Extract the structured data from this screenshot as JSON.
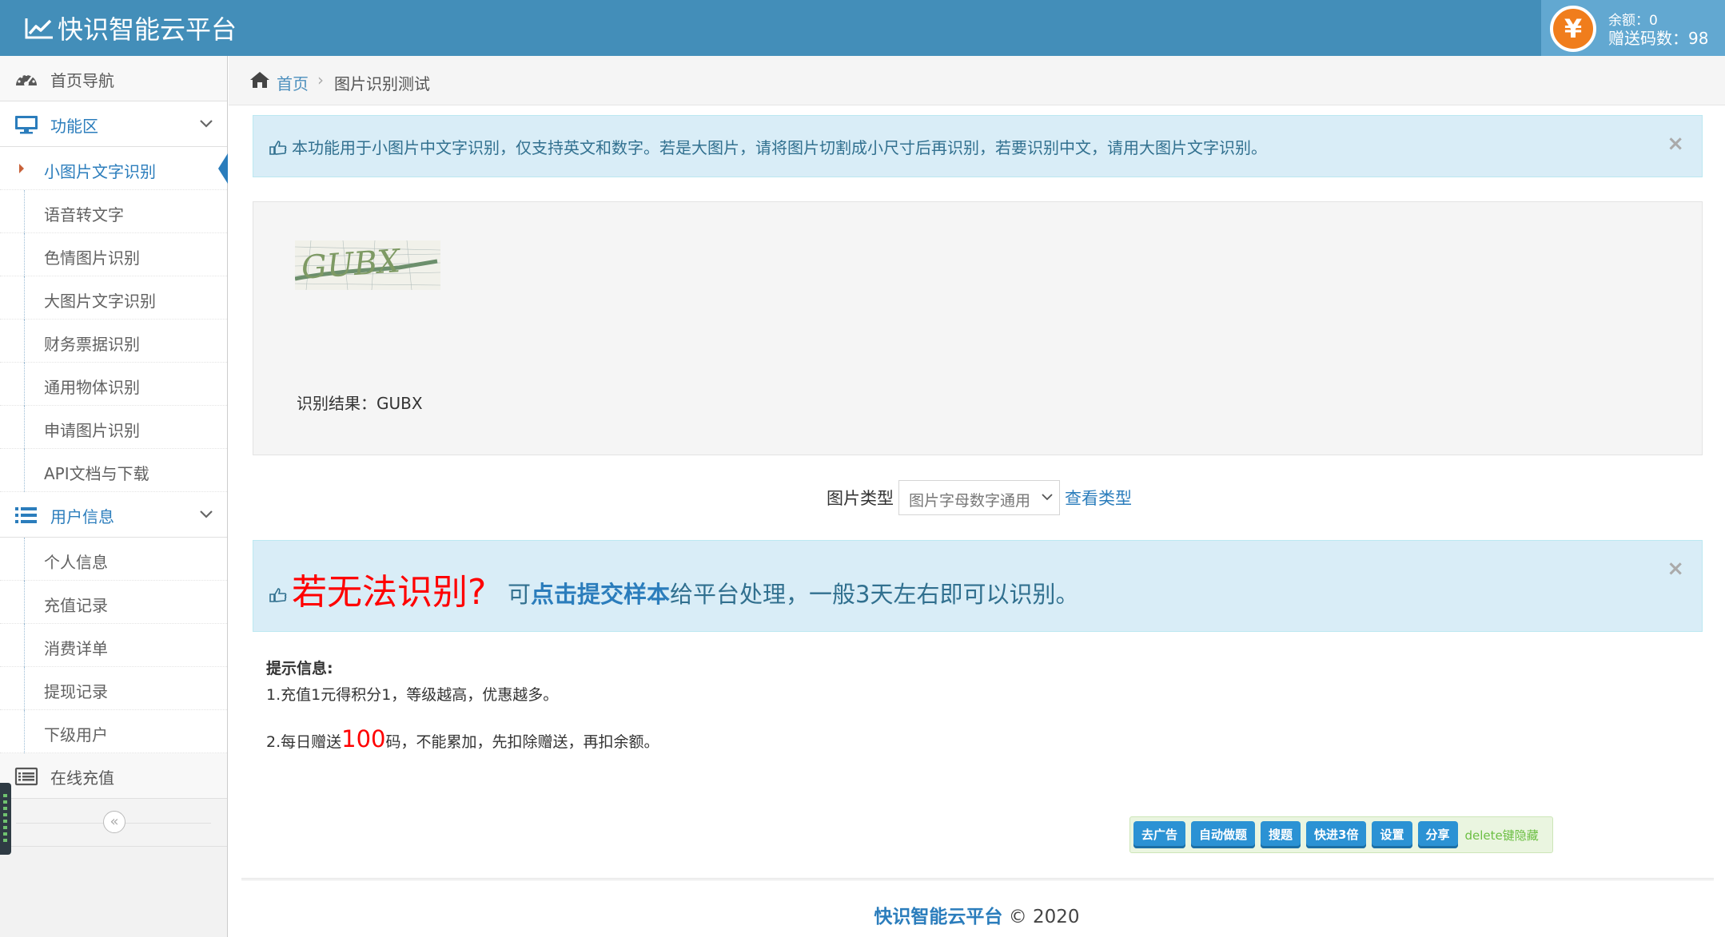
{
  "header": {
    "brand": "快识智能云平台",
    "coin_symbol": "¥",
    "balance_line": "余额：0",
    "gift_line": "赠送码数：98"
  },
  "sidebar": {
    "items": [
      {
        "label": "首页导航",
        "icon": "dashboard-icon"
      },
      {
        "label": "功能区",
        "icon": "desktop-icon",
        "children": [
          "小图片文字识别",
          "语音转文字",
          "色情图片识别",
          "大图片文字识别",
          "财务票据识别",
          "通用物体识别",
          "申请图片识别",
          "API文档与下载"
        ]
      },
      {
        "label": "用户信息",
        "icon": "list-icon",
        "children": [
          "个人信息",
          "充值记录",
          "消费详单",
          "提现记录",
          "下级用户"
        ]
      },
      {
        "label": "在线充值",
        "icon": "list-alt-icon"
      }
    ],
    "active": "小图片文字识别",
    "collapse_glyph": "«"
  },
  "breadcrumb": {
    "home": "首页",
    "separator": "›",
    "current": "图片识别测试"
  },
  "notice": {
    "text": "本功能用于小图片中文字识别，仅支持英文和数字。若是大图片，请将图片切割成小尺寸后再识别，若要识别中文，请用大图片文字识别。",
    "close": "×"
  },
  "recognition": {
    "result_label": "识别结果：",
    "result_value": "GUBX"
  },
  "type_selector": {
    "label": "图片类型",
    "selected": "图片字母数字通用",
    "link": "查看类型"
  },
  "fail_notice": {
    "big": "若无法识别?",
    "prefix": "可",
    "bold": "点击提交样本",
    "suffix": "给平台处理，一般3天左右即可以识别。",
    "close": "×"
  },
  "tips": {
    "title": "提示信息:",
    "line1": "1.充值1元得积分1，等级越高，优惠越多。",
    "line2_prefix": "2.每日赠送",
    "line2_highlight": "100",
    "line2_suffix": "码，不能累加，先扣除赠送，再扣余额。"
  },
  "extension_bar": {
    "buttons": [
      "去广告",
      "自动做题",
      "搜题",
      "快进3倍",
      "设置",
      "分享"
    ],
    "hint": "delete键隐藏"
  },
  "footer": {
    "brand": "快识智能云平台",
    "copyright": "© 2020"
  },
  "colors": {
    "topbar": "#438eb9",
    "accent": "#2b7dbc",
    "alert_bg": "#d9edf7",
    "alert_text": "#31708f",
    "highlight_red": "#ff0000",
    "coin": "#f07d1c"
  }
}
